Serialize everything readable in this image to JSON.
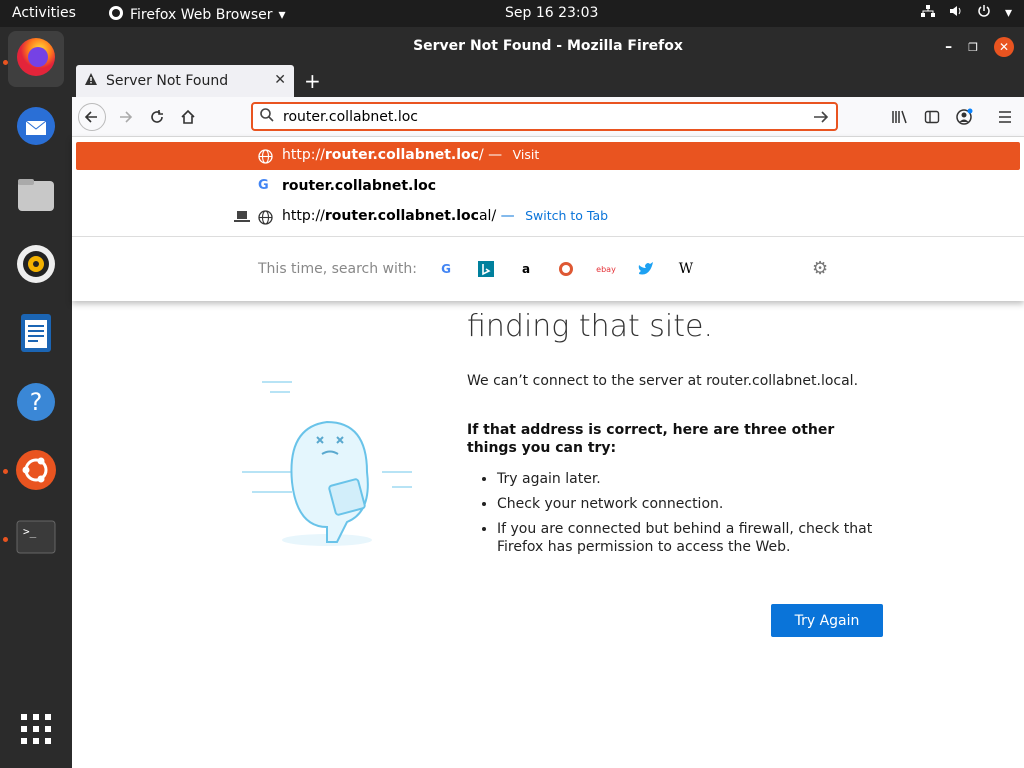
{
  "topbar": {
    "activities": "Activities",
    "app_name": "Firefox Web Browser",
    "clock": "Sep 16  23:03"
  },
  "window": {
    "title": "Server Not Found - Mozilla Firefox"
  },
  "tab": {
    "label": "Server Not Found"
  },
  "urlbar": {
    "value": "router.collabnet.loc"
  },
  "dropdown": {
    "suggestions": [
      {
        "prefix": "http://",
        "bold": "router.collabnet.loc",
        "suffix": "/",
        "separator": " — ",
        "action": "Visit"
      },
      {
        "prefix": "",
        "bold": "router.collabnet.loc",
        "suffix": "",
        "separator": "",
        "action": ""
      },
      {
        "prefix": "http://",
        "bold": "router.collabnet.loc",
        "suffix": "al/",
        "separator": " — ",
        "action": "Switch to Tab"
      }
    ],
    "search_with": "This time, search with:",
    "engines": [
      "google-icon",
      "bing-icon",
      "amazon-icon",
      "duckduckgo-icon",
      "ebay-icon",
      "twitter-icon",
      "wikipedia-icon"
    ]
  },
  "page": {
    "heading": "finding that site.",
    "lead": "We can’t connect to the server at router.collabnet.local.",
    "strong": "If that address is correct, here are three other things you can try:",
    "tips": [
      "Try again later.",
      "Check your network connection.",
      "If you are connected but behind a firewall, check that Firefox has permission to access the Web."
    ],
    "button": "Try Again"
  },
  "colors": {
    "accent": "#e95420",
    "button": "#0a74d9",
    "dark": "#2b2b2b"
  }
}
